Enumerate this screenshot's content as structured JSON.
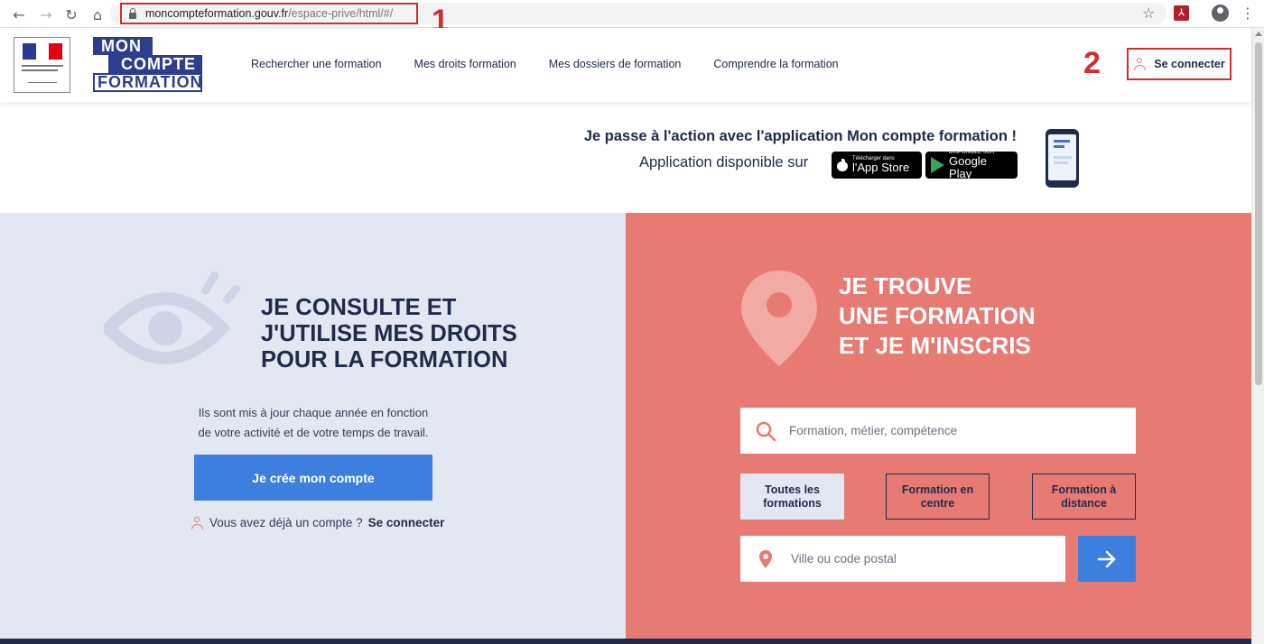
{
  "browser": {
    "url_host": "moncompteformation.gouv.fr",
    "url_path": "/espace-prive/html/#/",
    "annotation_1": "1",
    "annotation_2": "2"
  },
  "header": {
    "logo": {
      "line1": "MON",
      "line2": "COMPTE",
      "line3": "FORMATION"
    },
    "nav": [
      {
        "label": "Rechercher une formation"
      },
      {
        "label": "Mes droits formation"
      },
      {
        "label": "Mes dossiers de formation"
      },
      {
        "label": "Comprendre la formation"
      }
    ],
    "login_label": "Se connecter"
  },
  "promo": {
    "title": "Je passe à l'action avec l'application Mon compte formation !",
    "subtitle": "Application disponible sur",
    "app_store": {
      "small": "Télécharger dans",
      "big": "l'App Store"
    },
    "google_play": {
      "small": "DISPONIBLE SUR",
      "big": "Google Play"
    }
  },
  "left": {
    "title_lines": [
      "JE CONSULTE ET",
      "J'UTILISE MES DROITS",
      "POUR LA FORMATION"
    ],
    "desc_lines": [
      "Ils sont mis à jour chaque année en fonction",
      "de votre activité et de votre temps de travail."
    ],
    "create_button": "Je crée mon compte",
    "have_account_text": "Vous avez déjà un compte ?",
    "have_account_link": "Se connecter"
  },
  "right": {
    "title_lines": [
      "JE TROUVE",
      "UNE FORMATION",
      "ET JE M'INSCRIS"
    ],
    "search_placeholder": "Formation, métier, compétence",
    "filters": [
      {
        "line1": "Toutes les",
        "line2": "formations"
      },
      {
        "line1": "Formation en",
        "line2": "centre"
      },
      {
        "line1": "Formation à",
        "line2": "distance"
      }
    ],
    "city_placeholder": "Ville ou code postal"
  },
  "colors": {
    "navy": "#1e2b4a",
    "coral": "#e87a74",
    "blue_button": "#3c7fdf",
    "light_panel": "#e3e7f1",
    "annotation_red": "#d32d2d"
  },
  "icons": {
    "back": "back-arrow-icon",
    "forward": "forward-arrow-icon",
    "reload": "reload-icon",
    "home": "home-icon",
    "lock": "lock-icon",
    "star": "star-icon",
    "pdf": "pdf-extension-icon",
    "profile": "profile-icon",
    "menu": "kebab-menu-icon",
    "user": "person-icon",
    "eye": "eye-icon",
    "location": "location-pin-icon",
    "search": "search-icon",
    "arrow_right": "arrow-right-icon"
  }
}
